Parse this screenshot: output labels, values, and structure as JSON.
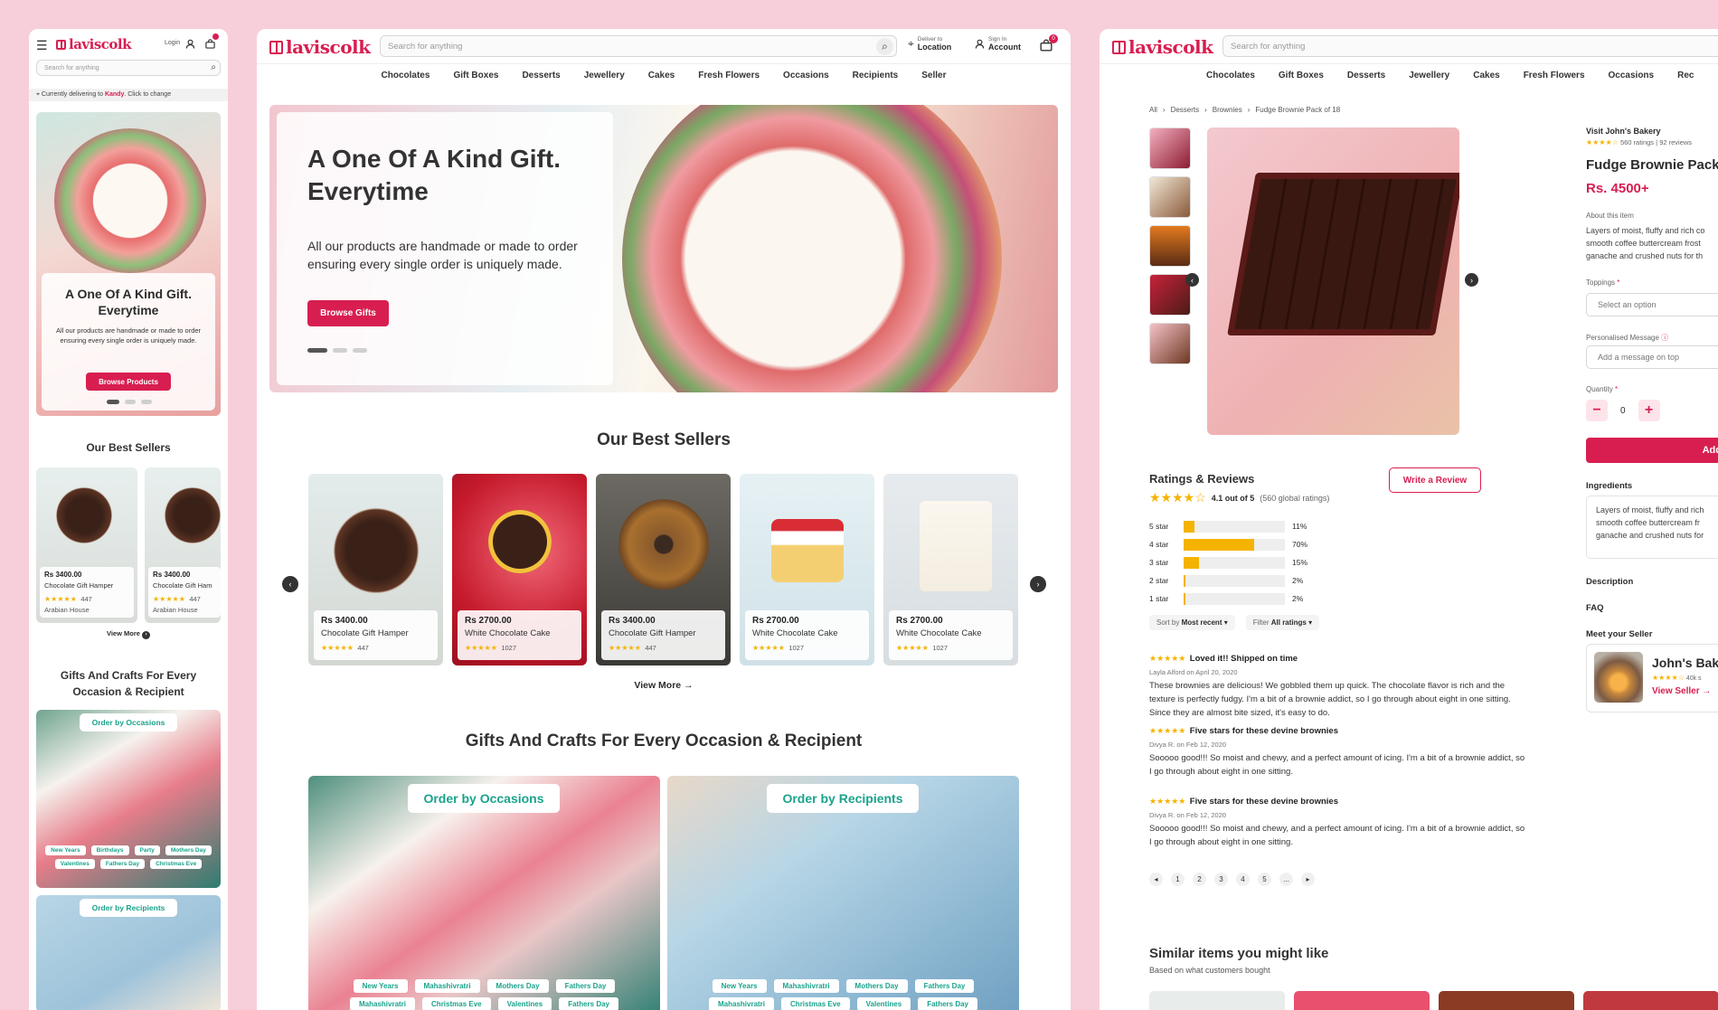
{
  "brand": "laviscolk",
  "mobile": {
    "login": "Login",
    "search_placeholder": "Search for anything",
    "delivery_prefix": "Currently delivering to ",
    "delivery_city": "Kandy",
    "delivery_suffix": ". Click to change",
    "hero_title": "A One Of A Kind Gift. Everytime",
    "hero_text": "All our products are handmade or made to order ensuring every single order is uniquely made.",
    "hero_button": "Browse Products",
    "best_sellers_title": "Our Best Sellers",
    "products": [
      {
        "price": "Rs 3400.00",
        "name": "Chocolate Gift Hamper",
        "reviews": "447",
        "shop": "Arabian House"
      },
      {
        "price": "Rs 3400.00",
        "name": "Chocolate Gift Ham",
        "reviews": "447",
        "shop": "Arabian House"
      }
    ],
    "view_more": "View More",
    "occasions_title": "Gifts And Crafts For Every Occasion & Recipient",
    "occasions_tag": "Order by Occasions",
    "occasion_chips": [
      "New Years",
      "Birthdays",
      "Party",
      "Mothers Day",
      "Valentines",
      "Fathers Day",
      "Christmas Eve"
    ],
    "recipients_tag": "Order by Recipients"
  },
  "desktop": {
    "search_placeholder": "Search for anything",
    "deliver_small": "Deliver to",
    "deliver_big": "Location",
    "signin_small": "Sign In",
    "signin_big": "Account",
    "cart_count": "0",
    "nav": [
      "Chocolates",
      "Gift Boxes",
      "Desserts",
      "Jewellery",
      "Cakes",
      "Fresh Flowers",
      "Occasions",
      "Recipients",
      "Seller"
    ],
    "hero_title": "A One Of A Kind Gift. Everytime",
    "hero_text": "All our products are handmade or made to order ensuring every single order is uniquely made.",
    "hero_button": "Browse Gifts",
    "best_sellers_title": "Our Best Sellers",
    "products": [
      {
        "price": "Rs 3400.00",
        "name": "Chocolate Gift Hamper",
        "reviews": "447"
      },
      {
        "price": "Rs 2700.00",
        "name": "White Chocolate Cake",
        "reviews": "1027"
      },
      {
        "price": "Rs 3400.00",
        "name": "Chocolate Gift Hamper",
        "reviews": "447"
      },
      {
        "price": "Rs 2700.00",
        "name": "White Chocolate Cake",
        "reviews": "1027"
      },
      {
        "price": "Rs 2700.00",
        "name": "White Chocolate Cake",
        "reviews": "1027"
      }
    ],
    "view_more": "View More",
    "occasions_title": "Gifts And Crafts For Every Occasion & Recipient",
    "occasions_tag": "Order by Occasions",
    "recipients_tag": "Order by Recipients",
    "chips": [
      "New Years",
      "Mahashivratri",
      "Mothers Day",
      "Fathers Day",
      "Mahashivratri",
      "Christmas Eve",
      "Valentines",
      "Fathers Day"
    ]
  },
  "product": {
    "search_placeholder": "Search for anything",
    "nav": [
      "Chocolates",
      "Gift Boxes",
      "Desserts",
      "Jewellery",
      "Cakes",
      "Fresh Flowers",
      "Occasions",
      "Rec"
    ],
    "breadcrumb": [
      "All",
      "Desserts",
      "Brownies",
      "Fudge Brownie Pack of 18"
    ],
    "seller_link": "Visit John's Bakery",
    "ratings_count": "560 ratings",
    "reviews_count": "92 reviews",
    "title": "Fudge Brownie Pack o",
    "price": "Rs. 4500+",
    "about_label": "About this item",
    "about_text": "Layers of moist, fluffy and rich co smooth coffee buttercream frost ganache and crushed nuts for th",
    "toppings_label": "Toppings",
    "toppings_placeholder": "Select an option",
    "message_label": "Personalised Message",
    "message_placeholder": "Add a message on top",
    "quantity_label": "Quantity",
    "quantity": "0",
    "add_button": "Add",
    "ingredients_label": "Ingredients",
    "ingredients_text": "Layers of moist, fluffy and rich smooth coffee buttercream fr ganache and crushed nuts for",
    "description_label": "Description",
    "faq_label": "FAQ",
    "meet_seller": "Meet your Seller",
    "seller_name": "John's Bak",
    "seller_count": "40k s",
    "view_seller": "View Seller",
    "reviews_title": "Ratings & Reviews",
    "write_review": "Write a Review",
    "avg": "4.1 out of 5",
    "global": "(560 global ratings)",
    "rating_rows": [
      {
        "label": "5 star",
        "pct": "11%",
        "value": 0.11
      },
      {
        "label": "4 star",
        "pct": "70%",
        "value": 0.7
      },
      {
        "label": "3 star",
        "pct": "15%",
        "value": 0.15
      },
      {
        "label": "2 star",
        "pct": "2%",
        "value": 0.02
      },
      {
        "label": "1 star",
        "pct": "2%",
        "value": 0.02
      }
    ],
    "sort_label": "Sort by",
    "sort_value": "Most recent",
    "filter_label": "Filter",
    "filter_value": "All ratings",
    "reviews": [
      {
        "title": "Loved it!! Shipped on time",
        "meta": "Layla Alford on April 20, 2020",
        "body": "These brownies are delicious! We gobbled them up quick. The chocolate flavor is rich and the texture is perfectly fudgy. I'm a bit of a brownie addict, so I go through about eight in one sitting. Since they are almost bite sized, it's easy to do."
      },
      {
        "title": "Five stars for these devine brownies",
        "meta": "Divya R. on Feb 12, 2020",
        "body": "Sooooo good!!! So moist and chewy, and a perfect amount of icing. I'm a bit of a brownie addict, so I go through about eight in one sitting."
      },
      {
        "title": "Five stars for these devine brownies",
        "meta": "Divya R. on Feb 12, 2020",
        "body": "Sooooo good!!! So moist and chewy, and a perfect amount of icing. I'm a bit of a brownie addict, so I go through about eight in one sitting."
      }
    ],
    "pages": [
      "1",
      "2",
      "3",
      "4",
      "5",
      "..."
    ],
    "similar_title": "Similar items you might like",
    "similar_sub": "Based on what customers bought"
  },
  "colors": {
    "accent": "#d81e50",
    "teal": "#1aa38c",
    "star": "#f5b301",
    "background": "#f7cfdb"
  }
}
